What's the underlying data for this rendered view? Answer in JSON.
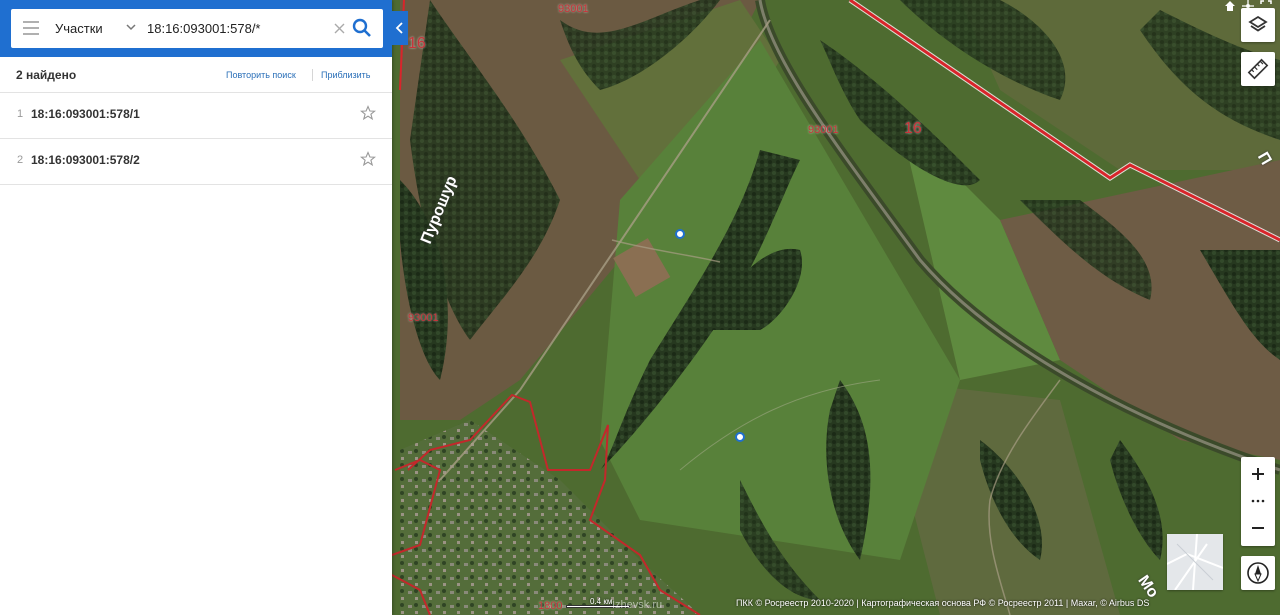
{
  "search": {
    "type_label": "Участки",
    "query": "18:16:093001:578/*"
  },
  "results": {
    "count_label": "2 найдено",
    "repeat_search": "Повторить поиск",
    "zoom_to": "Приблизить",
    "items": [
      {
        "num": "1",
        "label": "18:16:093001:578/1"
      },
      {
        "num": "2",
        "label": "18:16:093001:578/2"
      }
    ]
  },
  "map": {
    "labels": {
      "q93001_top": "93001",
      "q93001_mid": "93001",
      "q93001_left": "93001",
      "q16_left": "16",
      "q16_mid": "16",
      "q1800": "1800",
      "river_puroshur": "Пурошур",
      "road_right": "П",
      "road_bottom": "Мо"
    },
    "scale": "0.4 км",
    "watermark": "Izhevsk.ru",
    "attribution": "ПКК © Росреестр 2010-2020 | Картографическая основа РФ © Росреестр 2011 | Maxar, © Airbus DS"
  },
  "colors": {
    "header_blue": "#1f6fd0",
    "boundary_red": "#d8252b",
    "link_blue": "#2a6fb8"
  },
  "icons": [
    "menu-icon",
    "chevron-down-icon",
    "clear-icon",
    "search-icon",
    "star-icon",
    "layers-icon",
    "ruler-icon",
    "plus-icon",
    "minus-icon",
    "more-icon",
    "compass-icon",
    "home-icon",
    "locate-icon",
    "fullscreen-icon"
  ]
}
